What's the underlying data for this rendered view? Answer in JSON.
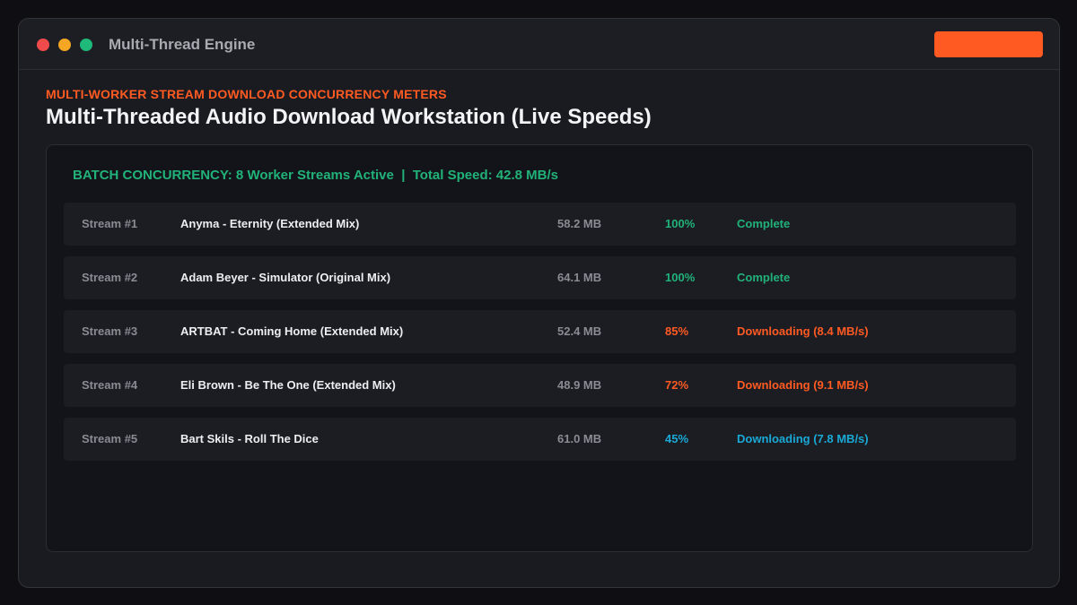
{
  "window": {
    "title": "Multi-Thread Engine",
    "accent_color": "#ff5a22"
  },
  "header": {
    "eyebrow": "MULTI-WORKER STREAM DOWNLOAD CONCURRENCY METERS",
    "title": "Multi-Threaded Audio Download Workstation (Live Speeds)"
  },
  "summary": {
    "text": "BATCH CONCURRENCY: 8 Worker Streams Active  |  Total Speed: 42.8 MB/s"
  },
  "colors": {
    "complete": "#21b27a",
    "downloading_orange": "#ff5a22",
    "downloading_cyan": "#1aa9d6"
  },
  "streams": [
    {
      "id": "Stream #1",
      "track": "Anyma - Eternity (Extended Mix)",
      "size": "58.2 MB",
      "progress": "100%",
      "status": "Complete",
      "color": "#21b27a"
    },
    {
      "id": "Stream #2",
      "track": "Adam Beyer - Simulator (Original Mix)",
      "size": "64.1 MB",
      "progress": "100%",
      "status": "Complete",
      "color": "#21b27a"
    },
    {
      "id": "Stream #3",
      "track": "ARTBAT - Coming Home (Extended Mix)",
      "size": "52.4 MB",
      "progress": "85%",
      "status": "Downloading (8.4 MB/s)",
      "color": "#ff5a22"
    },
    {
      "id": "Stream #4",
      "track": "Eli Brown - Be The One (Extended Mix)",
      "size": "48.9 MB",
      "progress": "72%",
      "status": "Downloading (9.1 MB/s)",
      "color": "#ff5a22"
    },
    {
      "id": "Stream #5",
      "track": "Bart Skils - Roll The Dice",
      "size": "61.0 MB",
      "progress": "45%",
      "status": "Downloading (7.8 MB/s)",
      "color": "#1aa9d6"
    }
  ]
}
